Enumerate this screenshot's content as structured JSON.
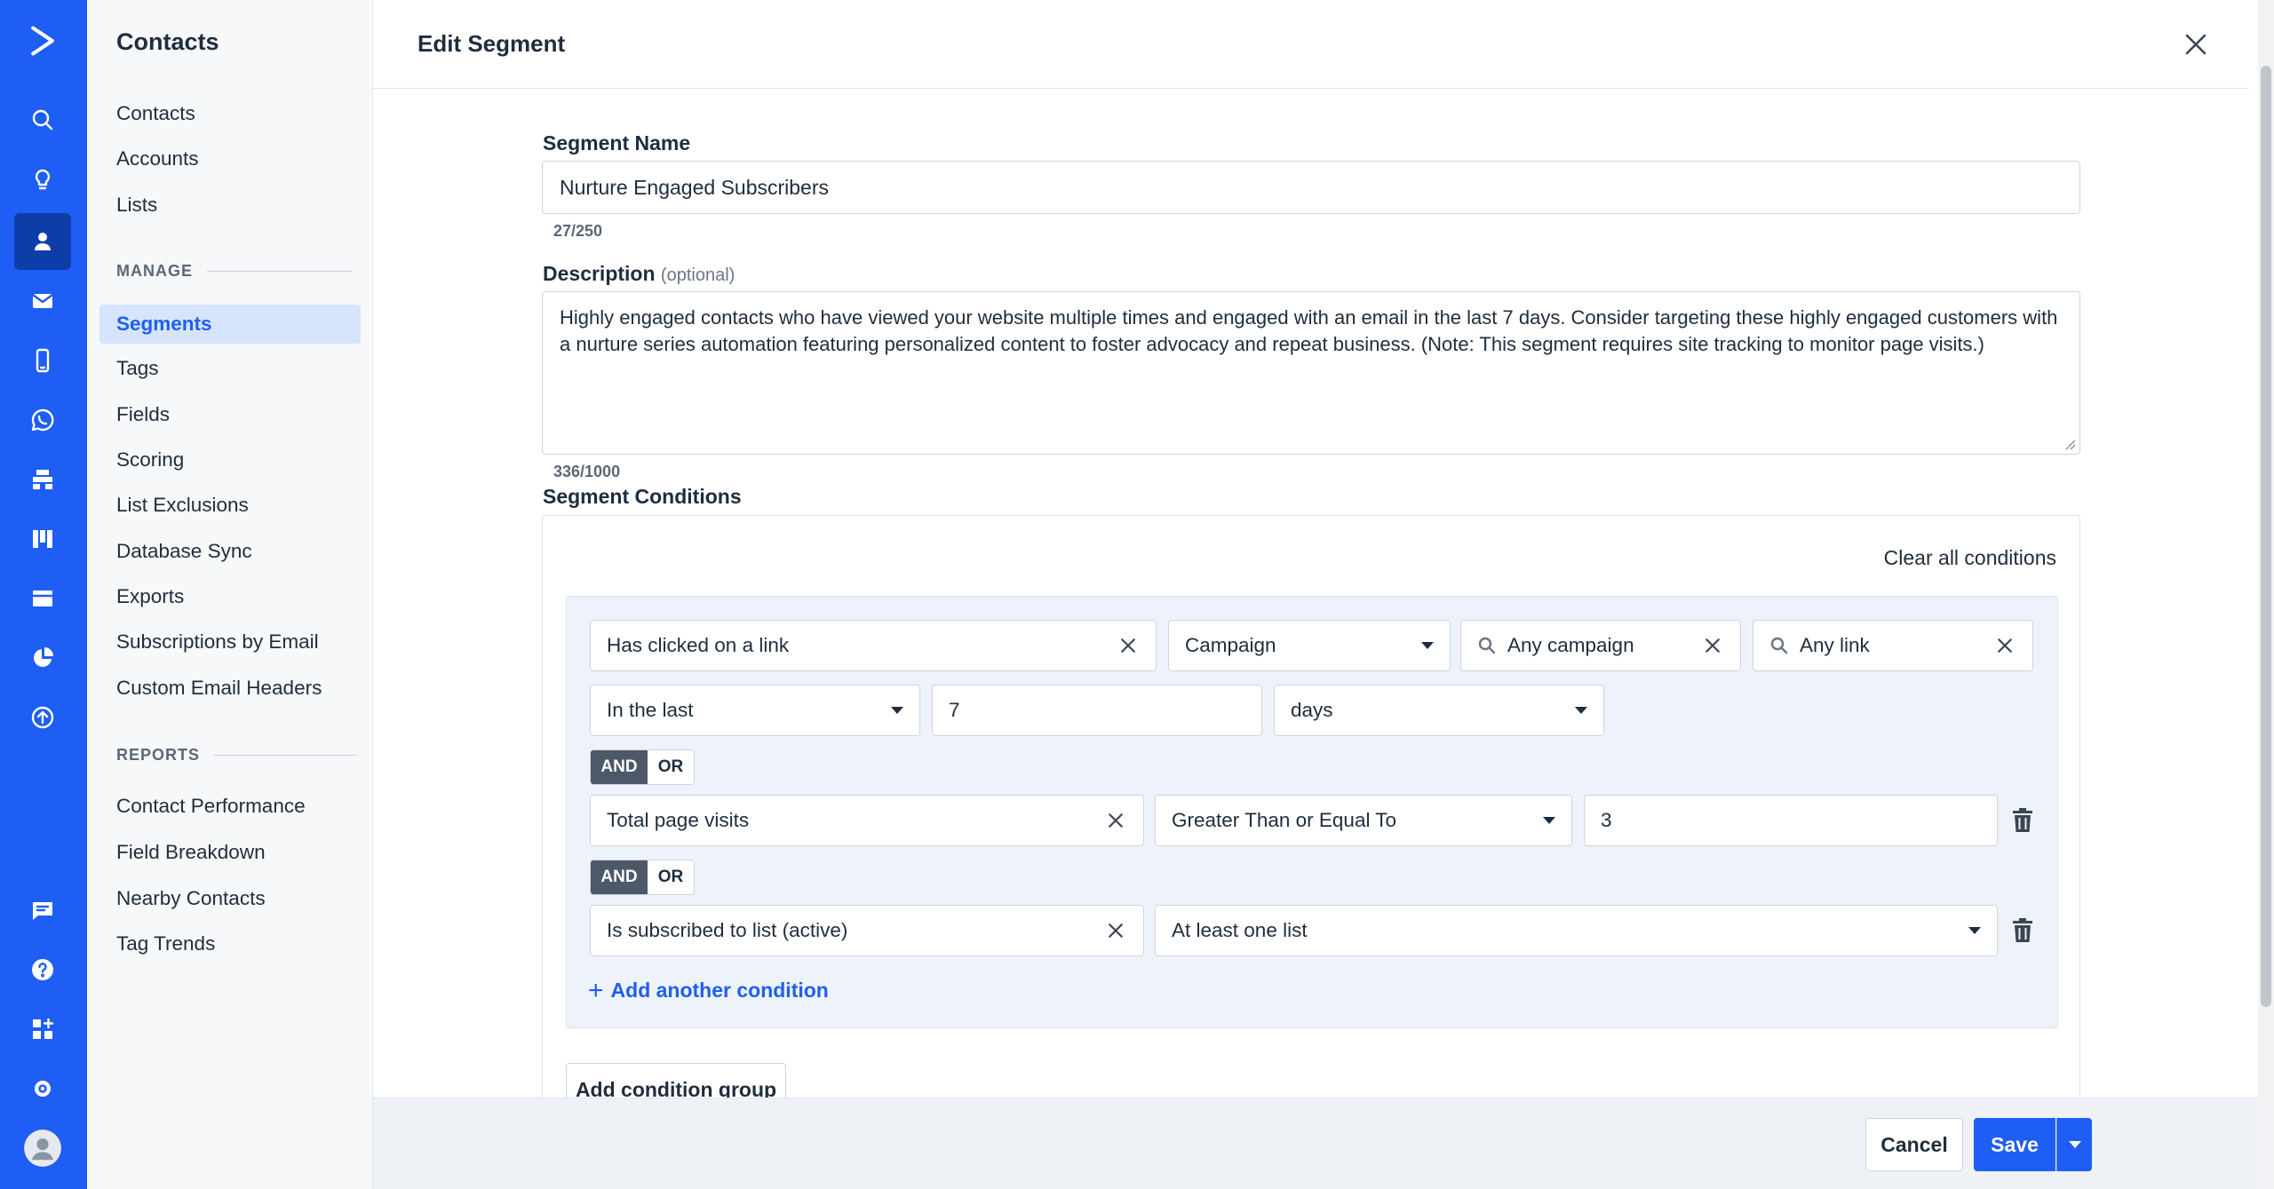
{
  "rail": {
    "icons": [
      "logo-chevron-icon",
      "search-icon",
      "lightbulb-icon",
      "contacts-icon",
      "email-icon",
      "mobile-icon",
      "whatsapp-icon",
      "automation-icon",
      "pipeline-icon",
      "site-icon",
      "reports-pie-icon",
      "upload-icon",
      "chat-icon",
      "help-icon",
      "apps-icon",
      "settings-icon",
      "user-avatar-icon"
    ],
    "active": "contacts-icon",
    "accent": "#1e5ef4"
  },
  "subnav": {
    "title": "Contacts",
    "top_items": [
      "Contacts",
      "Accounts",
      "Lists"
    ],
    "manage_label": "MANAGE",
    "manage_items": [
      "Segments",
      "Tags",
      "Fields",
      "Scoring",
      "List Exclusions",
      "Database Sync",
      "Exports",
      "Subscriptions by Email",
      "Custom Email Headers"
    ],
    "active_item": "Segments",
    "reports_label": "REPORTS",
    "report_items": [
      "Contact Performance",
      "Field Breakdown",
      "Nearby Contacts",
      "Tag Trends"
    ]
  },
  "header": {
    "title": "Edit Segment"
  },
  "form": {
    "name_label": "Segment Name",
    "name_value": "Nurture Engaged Subscribers",
    "name_counter": "27/250",
    "description_label": "Description",
    "description_optional": "(optional)",
    "description_value": "Highly engaged contacts who have viewed your website multiple times and engaged with an email in the last 7 days. Consider targeting these highly engaged customers with a nurture series automation featuring  personalized content to foster advocacy and repeat business. (Note: This segment requires site tracking to monitor page visits.)",
    "description_counter": "336/1000",
    "conditions_label": "Segment Conditions"
  },
  "conditions": {
    "clear_all": "Clear all conditions",
    "row1": {
      "condition": "Has clicked on a link",
      "type": "Campaign",
      "campaign": "Any campaign",
      "link": "Any link"
    },
    "row1b": {
      "timeframe": "In the last",
      "amount": "7",
      "unit": "days"
    },
    "join1": {
      "and": "AND",
      "or": "OR",
      "selected": "AND"
    },
    "row2": {
      "condition": "Total page visits",
      "operator": "Greater Than or Equal To",
      "value": "3"
    },
    "join2": {
      "and": "AND",
      "or": "OR",
      "selected": "AND"
    },
    "row3": {
      "condition": "Is subscribed to list (active)",
      "lists": "At least one list"
    },
    "add_condition": "Add another condition",
    "add_group": "Add condition group"
  },
  "footer": {
    "cancel": "Cancel",
    "save": "Save"
  }
}
